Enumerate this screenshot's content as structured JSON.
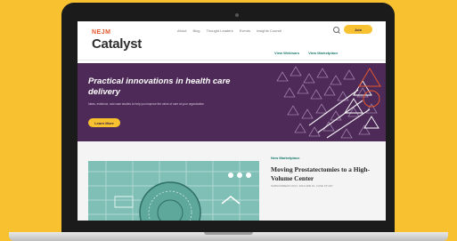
{
  "site": {
    "logo_top": "NEJM",
    "logo_main": "Catalyst"
  },
  "nav": {
    "items": [
      "About",
      "Blog",
      "Thought Leaders",
      "Events",
      "Insights Council"
    ],
    "join_label": "Join"
  },
  "subnav": {
    "items": [
      "View Webinars",
      "View Marketplace"
    ]
  },
  "hero": {
    "title": "Practical innovations in health care delivery",
    "subtitle": "Ideas, evidence, and case studies to help you improve the value of care at your organization",
    "cta_label": "Learn More"
  },
  "article": {
    "eyebrow": "New Marketplace",
    "title": "Moving Prostatectomies to a High-Volume Center",
    "meta": "SUBSCRIBERS ONLY, 2016 FEB 23, CASE STUDY"
  },
  "colors": {
    "background": "#f7c12f",
    "hero": "#4d2a57",
    "accent": "#f7c12f",
    "teal": "#1a7b6e",
    "card": "#7fbfb5"
  }
}
